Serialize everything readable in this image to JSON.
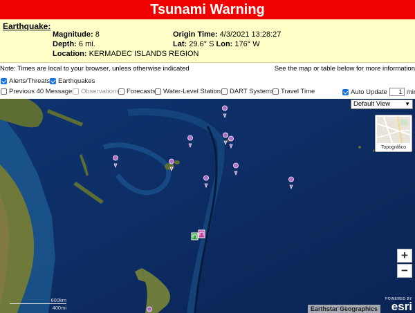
{
  "banner": {
    "title": "Tsunami Warning",
    "color": "#f00000"
  },
  "earthquake": {
    "heading": "Earthquake",
    "heading_colon": ":",
    "magnitude_label": "Magnitude:",
    "magnitude_value": "8",
    "depth_label": "Depth:",
    "depth_value": "6 mi.",
    "location_label": "Location:",
    "location_value": "KERMADEC ISLANDS REGION",
    "origin_time_label": "Origin Time:",
    "origin_time_value": "4/3/2021 13:28:27",
    "lat_label": "Lat:",
    "lat_value": "29.6° S",
    "lon_label": "Lon:",
    "lon_value": "176° W"
  },
  "notes": {
    "left": "Note: Times are local to your browser, unless otherwise indicated",
    "right": "See the map or table below for more information"
  },
  "options": {
    "alerts_threats": {
      "label": "Alerts/Threats",
      "checked": true
    },
    "earthquakes": {
      "label": "Earthquakes",
      "checked": true
    },
    "previous_messages": {
      "label": "Previous 40 Messages",
      "checked": false
    },
    "observations": {
      "label": "Observations",
      "checked": false,
      "disabled": true
    },
    "forecasts": {
      "label": "Forecasts",
      "checked": false
    },
    "water_level": {
      "label": "Water-Level Stations",
      "checked": false
    },
    "dart": {
      "label": "DART Systems",
      "checked": false
    },
    "travel_time": {
      "label": "Travel Time",
      "checked": false
    },
    "auto_update": {
      "label": "Auto Update",
      "checked": true,
      "value": "1",
      "unit": "min"
    }
  },
  "map": {
    "view_select": "Default View",
    "basemap_label": "Topográfico",
    "zoom_in": "+",
    "zoom_out": "−",
    "attribution": "Earthstar Geographics",
    "esri_powered": "POWERED BY",
    "esri_logo": "esri",
    "scale_km": "600km",
    "scale_mi": "400mi",
    "marker_color": "#b06ec8",
    "warning_marker_color": "#2e9e3e"
  }
}
